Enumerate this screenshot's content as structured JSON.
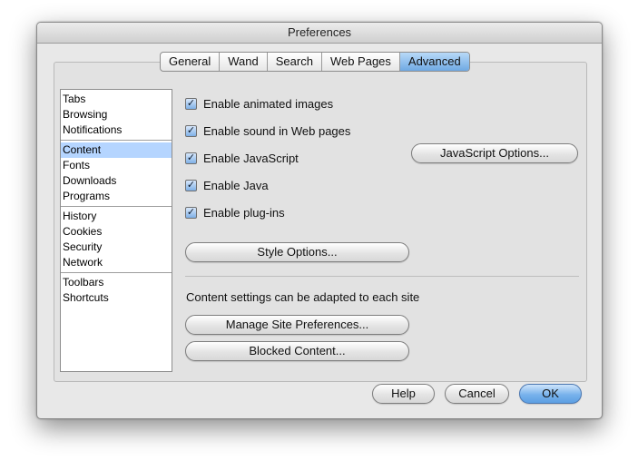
{
  "window": {
    "title": "Preferences"
  },
  "tabs": [
    "General",
    "Wand",
    "Search",
    "Web Pages",
    "Advanced"
  ],
  "sidebar": {
    "groups": [
      [
        "Tabs",
        "Browsing",
        "Notifications"
      ],
      [
        "Content",
        "Fonts",
        "Downloads",
        "Programs"
      ],
      [
        "History",
        "Cookies",
        "Security",
        "Network"
      ],
      [
        "Toolbars",
        "Shortcuts"
      ]
    ],
    "selected": "Content"
  },
  "checkboxes": [
    {
      "label": "Enable animated images",
      "checked": true
    },
    {
      "label": "Enable sound in Web pages",
      "checked": true
    },
    {
      "label": "Enable JavaScript",
      "checked": true
    },
    {
      "label": "Enable Java",
      "checked": true
    },
    {
      "label": "Enable plug-ins",
      "checked": true
    }
  ],
  "buttons": {
    "javascript_options": "JavaScript Options...",
    "style_options": "Style Options...",
    "manage_site_prefs": "Manage Site Preferences...",
    "blocked_content": "Blocked Content...",
    "help": "Help",
    "cancel": "Cancel",
    "ok": "OK"
  },
  "content_note": "Content settings can be adapted to each site",
  "colors": {
    "accent": "#6fa9e3",
    "selection": "#b5d5ff"
  }
}
